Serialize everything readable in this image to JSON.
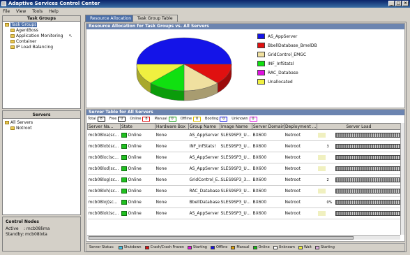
{
  "window": {
    "title": "Adaptive Services Control Center"
  },
  "menu": [
    "File",
    "View",
    "Tools",
    "Help"
  ],
  "left": {
    "task_groups_header": "Task Groups",
    "task_groups": [
      {
        "label": "Task Groups",
        "level": 0,
        "selected": true
      },
      {
        "label": "AgentBoss",
        "level": 1
      },
      {
        "label": "Application Monitoring",
        "level": 1
      },
      {
        "label": "Container",
        "level": 1
      },
      {
        "label": "IP Load Balancing",
        "level": 1
      }
    ],
    "servers_header": "Servers",
    "servers": [
      {
        "label": "All Servers",
        "level": 0
      },
      {
        "label": "Notroot",
        "level": 1
      }
    ],
    "control_nodes": {
      "title": "Control Nodes",
      "active_label": "Active",
      "active_value": ": mcb08lima",
      "standby_label": "Standby:",
      "standby_value": "mcb08lxta"
    }
  },
  "tabs": [
    {
      "label": "Resource Allocation",
      "active": true
    },
    {
      "label": "Task Group Table",
      "active": false
    }
  ],
  "allocation": {
    "title": "Resource Allocation for Task Groups vs. All Servers"
  },
  "chart_data": {
    "type": "pie",
    "title": "",
    "categories": [
      "AS_AppServer",
      "BbellDatabase_BmelDB",
      "GridControl_EMGC",
      "INF_InfStatsl",
      "RAC_Database",
      "Unallocated"
    ],
    "values": [
      50,
      12.5,
      12.5,
      12.5,
      0,
      12.5
    ],
    "colors": [
      "#1414e8",
      "#e01010",
      "#f0e0a0",
      "#10e010",
      "#e010e0",
      "#f0f040"
    ],
    "legend_position": "right"
  },
  "server_table": {
    "title": "Server Table for All Servers",
    "filters": [
      {
        "label": "Total",
        "count": "8",
        "color": "#000000"
      },
      {
        "label": "Free",
        "count": "0",
        "color": "#000000"
      },
      {
        "label": "Online",
        "count": "8",
        "color": "#e01010"
      },
      {
        "label": "Manual",
        "count": "0",
        "color": "#10a010"
      },
      {
        "label": "Offline",
        "count": "0",
        "color": "#e0c000"
      },
      {
        "label": "Booting",
        "count": "0",
        "color": "#1414e8"
      },
      {
        "label": "Unknown",
        "count": "0",
        "color": "#e010e0"
      }
    ],
    "columns": [
      "Server Na...",
      "State",
      "Hardware Box",
      "Group Name",
      "Image Name",
      "Server Domain",
      "Deployment ...",
      "Server Load"
    ],
    "rows": [
      {
        "name": "mcb08lxa(sc...",
        "state": "Online",
        "hw": "None",
        "group": "AS_AppServer",
        "image": "SLES9SP3_U...",
        "domain": "BX600",
        "deploy": "Netroot",
        "load_num": ""
      },
      {
        "name": "mcb08lxb(sc...",
        "state": "Online",
        "hw": "None",
        "group": "INF_InfStats!",
        "image": "SLES9SP3_U...",
        "domain": "BX600",
        "deploy": "Netroot",
        "load_num": "3"
      },
      {
        "name": "mcb08lxc(sc...",
        "state": "Online",
        "hw": "None",
        "group": "AS_AppServer",
        "image": "SLES9SP3_U...",
        "domain": "BX600",
        "deploy": "Netroot",
        "load_num": ""
      },
      {
        "name": "mcb08lxd(sc...",
        "state": "Online",
        "hw": "None",
        "group": "AS_AppServer",
        "image": "SLES9SP3_U...",
        "domain": "BX600",
        "deploy": "Netroot",
        "load_num": ""
      },
      {
        "name": "mcb08lxg(sc...",
        "state": "Online",
        "hw": "None",
        "group": "GridControl_E...",
        "image": "SLES9SP3_3...",
        "domain": "BX600",
        "deploy": "Netroot",
        "load_num": "2"
      },
      {
        "name": "mcb08lxh(sc...",
        "state": "Online",
        "hw": "None",
        "group": "RAC_Database",
        "image": "SLES9SP3_U...",
        "domain": "BX600",
        "deploy": "Netroot",
        "load_num": ""
      },
      {
        "name": "mcb08lxj(sc...",
        "state": "Online",
        "hw": "None",
        "group": "BbellDatabase...",
        "image": "SLES9SP3_U...",
        "domain": "BX600",
        "deploy": "Netroot",
        "load_num": "0%"
      },
      {
        "name": "mcb08lxk(sc...",
        "state": "Online",
        "hw": "None",
        "group": "AS_AppServer",
        "image": "SLES9SP3_U...",
        "domain": "BX600",
        "deploy": "Netroot",
        "load_num": ""
      }
    ]
  },
  "status_legend": {
    "label": "Server Status:",
    "items": [
      {
        "label": "Shutdown",
        "color": "#40c0e0"
      },
      {
        "label": "Crash/Crash Frozen",
        "color": "#e01010"
      },
      {
        "label": "Starting",
        "color": "#e010e0"
      },
      {
        "label": "Offline",
        "color": "#1414e8"
      },
      {
        "label": "Manual",
        "color": "#e0a000"
      },
      {
        "label": "Online",
        "color": "#10c010"
      },
      {
        "label": "Unknown",
        "color": "#ffffff"
      },
      {
        "label": "Wait",
        "color": "#f0f040"
      },
      {
        "label": "Starting",
        "color": "#e0b0e0"
      }
    ]
  }
}
